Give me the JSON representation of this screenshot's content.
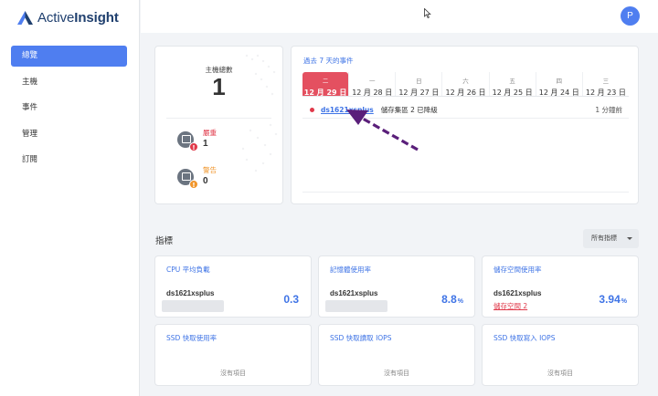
{
  "app": {
    "logo_text_regular": "Active",
    "logo_text_bold": "Insight",
    "avatar_initial": "P"
  },
  "sidebar": {
    "items": [
      {
        "label": "總覽",
        "active": true
      },
      {
        "label": "主機",
        "active": false
      },
      {
        "label": "事件",
        "active": false
      },
      {
        "label": "管理",
        "active": false
      },
      {
        "label": "訂閱",
        "active": false
      }
    ]
  },
  "hosts": {
    "label": "主機總數",
    "count": "1",
    "critical": {
      "label": "嚴重",
      "count": "1",
      "color": "#e0394a"
    },
    "warning": {
      "label": "警告",
      "count": "0",
      "color": "#f0952b"
    }
  },
  "events": {
    "title": "過去 7 天的事件",
    "days": [
      {
        "weekday": "二",
        "date": "12 月 29 日",
        "active": true
      },
      {
        "weekday": "一",
        "date": "12 月 28 日",
        "active": false
      },
      {
        "weekday": "日",
        "date": "12 月 27 日",
        "active": false
      },
      {
        "weekday": "六",
        "date": "12 月 26 日",
        "active": false
      },
      {
        "weekday": "五",
        "date": "12 月 25 日",
        "active": false
      },
      {
        "weekday": "四",
        "date": "12 月 24 日",
        "active": false
      },
      {
        "weekday": "三",
        "date": "12 月 23 日",
        "active": false
      }
    ],
    "items": [
      {
        "host": "ds1621xsplus",
        "description": "儲存集區 2 已降級",
        "time": "1 分鐘前"
      }
    ]
  },
  "metrics": {
    "title": "指標",
    "dropdown_label": "所有指標",
    "cards": [
      {
        "title": "CPU 平均負載",
        "host": "ds1621xsplus",
        "value": "0.3",
        "unit": "",
        "sub": ""
      },
      {
        "title": "記憶體使用率",
        "host": "ds1621xsplus",
        "value": "8.8",
        "unit": "%",
        "sub": ""
      },
      {
        "title": "儲存空間使用率",
        "host": "ds1621xsplus",
        "value": "3.94",
        "unit": "%",
        "sub": "儲存空間 2"
      },
      {
        "title": "SSD 快取使用率",
        "empty": "沒有項目"
      },
      {
        "title": "SSD 快取讀取 IOPS",
        "empty": "沒有項目"
      },
      {
        "title": "SSD 快取寫入 IOPS",
        "empty": "沒有項目"
      }
    ]
  },
  "colors": {
    "accent": "#4f7ef0",
    "link": "#3f74e6",
    "critical": "#e0394a",
    "warning": "#f0952b",
    "annotation_arrow": "#5a1f7a"
  }
}
